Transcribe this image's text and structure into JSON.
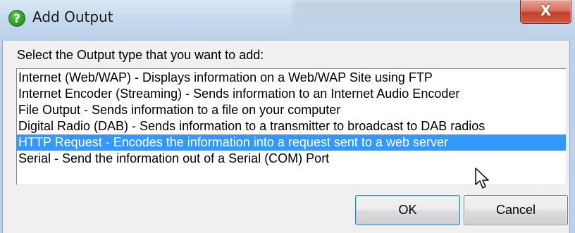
{
  "window": {
    "title": "Add Output",
    "title_icon": "help-question-icon",
    "close_glyph": "X"
  },
  "dialog": {
    "prompt": "Select the Output type that you want to add:",
    "selected_index": 4,
    "items": [
      {
        "label": "Internet (Web/WAP) - Displays information on a Web/WAP Site using FTP"
      },
      {
        "label": "Internet Encoder (Streaming) - Sends information to an Internet Audio Encoder"
      },
      {
        "label": "File Output - Sends information to a file on your computer"
      },
      {
        "label": "Digital Radio (DAB) - Sends information to a transmitter to broadcast to DAB radios"
      },
      {
        "label": "HTTP Request - Encodes the information into a request sent to a web server"
      },
      {
        "label": "Serial - Send the information out of a Serial (COM) Port"
      }
    ],
    "ok_label": "OK",
    "cancel_label": "Cancel"
  },
  "colors": {
    "selection": "#3399ff",
    "selection_text": "#ffffff",
    "dialog_bg": "#f0f0f0",
    "close_button": "#c7503c"
  }
}
